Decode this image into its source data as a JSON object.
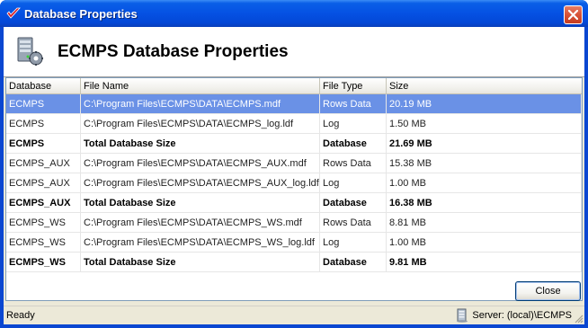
{
  "window": {
    "title": "Database Properties",
    "app_icon": "checkmark-logo-icon",
    "close_icon": "close-icon"
  },
  "header": {
    "icon": "database-server-icon",
    "title": "ECMPS Database Properties"
  },
  "grid": {
    "columns": [
      "Database",
      "File Name",
      "File Type",
      "Size"
    ],
    "rows": [
      {
        "database": "ECMPS",
        "file_name": "C:\\Program Files\\ECMPS\\DATA\\ECMPS.mdf",
        "file_type": "Rows Data",
        "size": "20.19 MB",
        "total": false,
        "selected": true
      },
      {
        "database": "ECMPS",
        "file_name": "C:\\Program Files\\ECMPS\\DATA\\ECMPS_log.ldf",
        "file_type": "Log",
        "size": "1.50 MB",
        "total": false,
        "selected": false
      },
      {
        "database": "ECMPS",
        "file_name": "Total Database Size",
        "file_type": "Database",
        "size": "21.69 MB",
        "total": true,
        "selected": false
      },
      {
        "database": "ECMPS_AUX",
        "file_name": "C:\\Program Files\\ECMPS\\DATA\\ECMPS_AUX.mdf",
        "file_type": "Rows Data",
        "size": "15.38 MB",
        "total": false,
        "selected": false
      },
      {
        "database": "ECMPS_AUX",
        "file_name": "C:\\Program Files\\ECMPS\\DATA\\ECMPS_AUX_log.ldf",
        "file_type": "Log",
        "size": "1.00 MB",
        "total": false,
        "selected": false
      },
      {
        "database": "ECMPS_AUX",
        "file_name": "Total Database Size",
        "file_type": "Database",
        "size": "16.38 MB",
        "total": true,
        "selected": false
      },
      {
        "database": "ECMPS_WS",
        "file_name": "C:\\Program Files\\ECMPS\\DATA\\ECMPS_WS.mdf",
        "file_type": "Rows Data",
        "size": "8.81 MB",
        "total": false,
        "selected": false
      },
      {
        "database": "ECMPS_WS",
        "file_name": "C:\\Program Files\\ECMPS\\DATA\\ECMPS_WS_log.ldf",
        "file_type": "Log",
        "size": "1.00 MB",
        "total": false,
        "selected": false
      },
      {
        "database": "ECMPS_WS",
        "file_name": "Total Database Size",
        "file_type": "Database",
        "size": "9.81 MB",
        "total": true,
        "selected": false
      }
    ]
  },
  "buttons": {
    "close_label": "Close"
  },
  "statusbar": {
    "status": "Ready",
    "server_icon": "server-icon",
    "server": "Server: (local)\\ECMPS"
  },
  "colors": {
    "selection": "#6a91e6",
    "titlebar": "#0551e3",
    "face": "#ece9d8"
  }
}
